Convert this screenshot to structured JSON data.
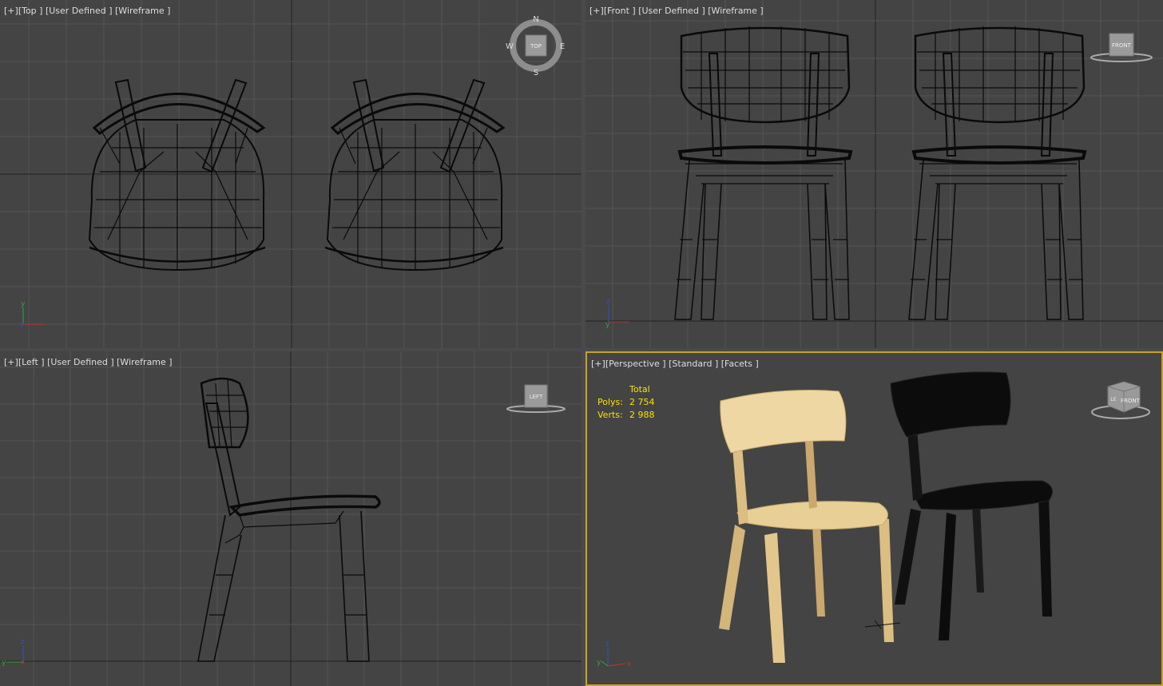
{
  "viewports": {
    "top": {
      "plus": "[+]",
      "view": "[Top ]",
      "mode": "[User Defined ]",
      "shading": "[Wireframe ]",
      "compass": {
        "n": "N",
        "s": "S",
        "e": "E",
        "w": "W",
        "cube_face": "TOP"
      }
    },
    "front": {
      "plus": "[+]",
      "view": "[Front ]",
      "mode": "[User Defined ]",
      "shading": "[Wireframe ]",
      "cube_face": "FRONT"
    },
    "left": {
      "plus": "[+]",
      "view": "[Left ]",
      "mode": "[User Defined ]",
      "shading": "[Wireframe ]",
      "cube_face": "LEFT"
    },
    "perspective": {
      "plus": "[+]",
      "view": "[Perspective ]",
      "mode": "[Standard ]",
      "shading": "[Facets ]",
      "cube_face": "FRONT",
      "cube_side": "LE",
      "stats": {
        "header": "Total",
        "polys_label": "Polys:",
        "polys": "2 754",
        "verts_label": "Verts:",
        "verts": "2 988"
      }
    }
  },
  "axes": {
    "x": "x",
    "y": "y",
    "z": "z"
  },
  "colors": {
    "viewport_bg": "#444444",
    "grid": "#555555",
    "grid_axis": "#222222",
    "active_border": "#c9a227",
    "stats_text": "#ffe100",
    "wire": "#0a0a0a",
    "chair_wood": "#e8cf96",
    "chair_black": "#0c0c0c"
  }
}
